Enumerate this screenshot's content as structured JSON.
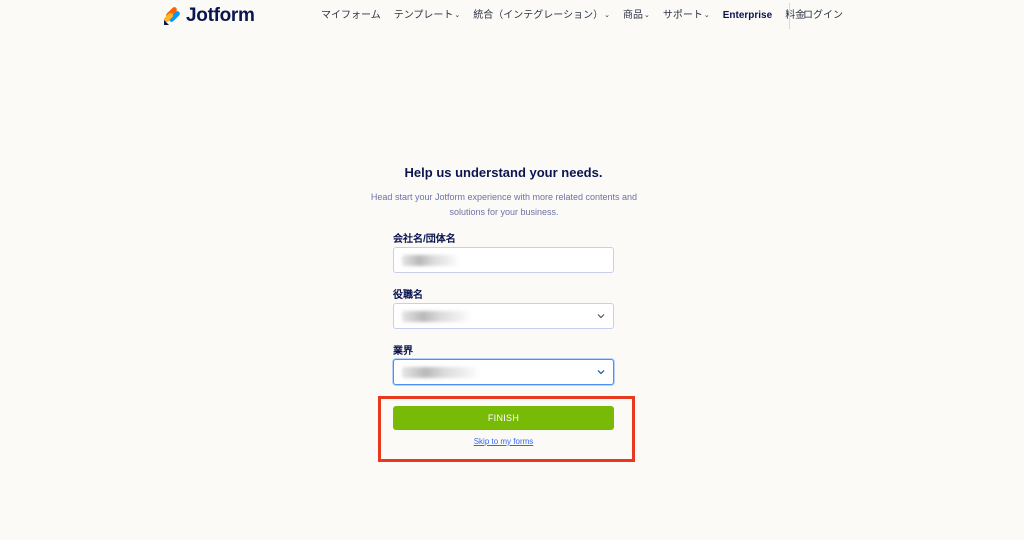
{
  "header": {
    "brand": "Jotform",
    "nav": [
      {
        "label": "マイフォーム",
        "caret": false
      },
      {
        "label": "テンプレート",
        "caret": true
      },
      {
        "label": "統合（インテグレーション）",
        "caret": true
      },
      {
        "label": "商品",
        "caret": true
      },
      {
        "label": "サポート",
        "caret": true
      },
      {
        "label": "Enterprise",
        "caret": false
      },
      {
        "label": "料金",
        "caret": false
      }
    ],
    "login_label": "ログイン"
  },
  "form": {
    "title": "Help us understand your needs.",
    "subtitle_line1": "Head start your Jotform experience with more related contents and",
    "subtitle_line2": "solutions for your business.",
    "company": {
      "label": "会社名/団体名",
      "value": ""
    },
    "role": {
      "label": "役職名",
      "value": ""
    },
    "industry": {
      "label": "業界",
      "value": ""
    },
    "finish_label": "FINISH",
    "skip_label": "Skip to my forms"
  },
  "colors": {
    "brand_navy": "#0a1551",
    "finish_green": "#78bb07",
    "link_blue": "#2e69ff",
    "highlight_red": "#e8391e",
    "background": "#fbfaf6"
  },
  "icons": {
    "logo": "jotform-logo-icon",
    "dropdown": "chevron-down-icon"
  }
}
